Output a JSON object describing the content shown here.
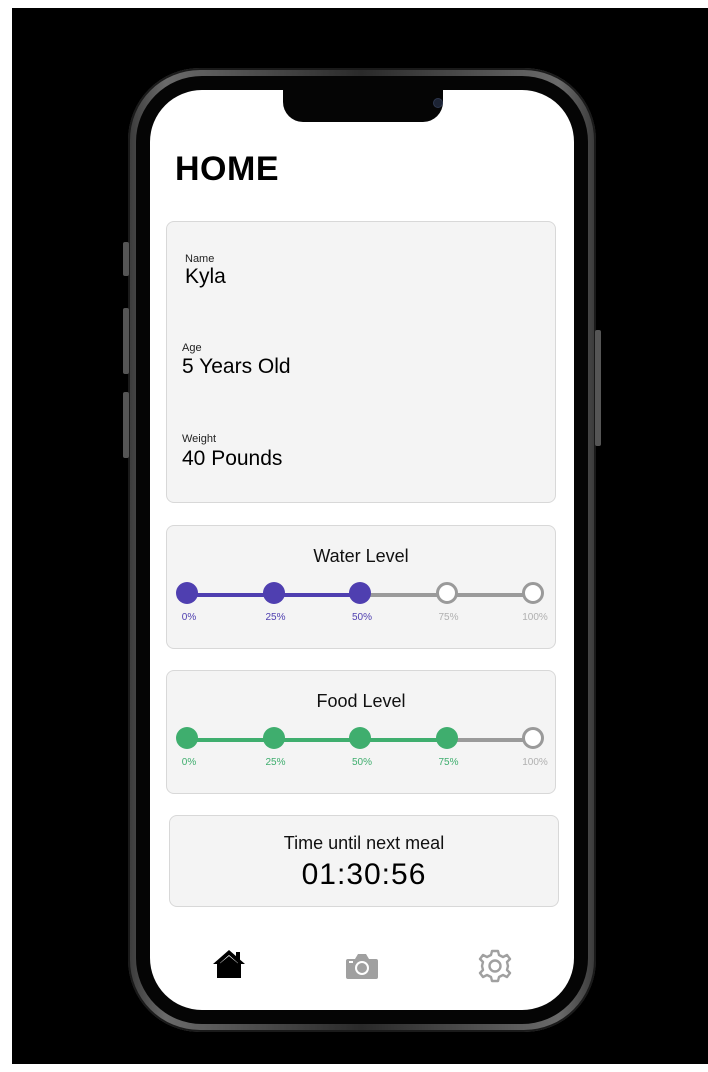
{
  "page": {
    "title": "HOME"
  },
  "pet": {
    "name_label": "Name",
    "name": "Kyla",
    "age_label": "Age",
    "age": "5 Years Old",
    "weight_label": "Weight",
    "weight": "40 Pounds"
  },
  "water": {
    "title": "Water Level",
    "level_percent": 50,
    "ticks": [
      "0%",
      "25%",
      "50%",
      "75%",
      "100%"
    ],
    "color": "#4f3fb0"
  },
  "food": {
    "title": "Food Level",
    "level_percent": 75,
    "ticks": [
      "0%",
      "25%",
      "50%",
      "75%",
      "100%"
    ],
    "color": "#3fae6e"
  },
  "timer": {
    "label": "Time until next meal",
    "value": "01:30:56"
  },
  "tabbar": {
    "items": [
      {
        "icon": "home-icon",
        "active": true
      },
      {
        "icon": "camera-icon",
        "active": false
      },
      {
        "icon": "gear-icon",
        "active": false
      }
    ],
    "active_color": "#000000",
    "inactive_color": "#a0a0a0"
  },
  "colors": {
    "empty": "#9a9a9a"
  }
}
